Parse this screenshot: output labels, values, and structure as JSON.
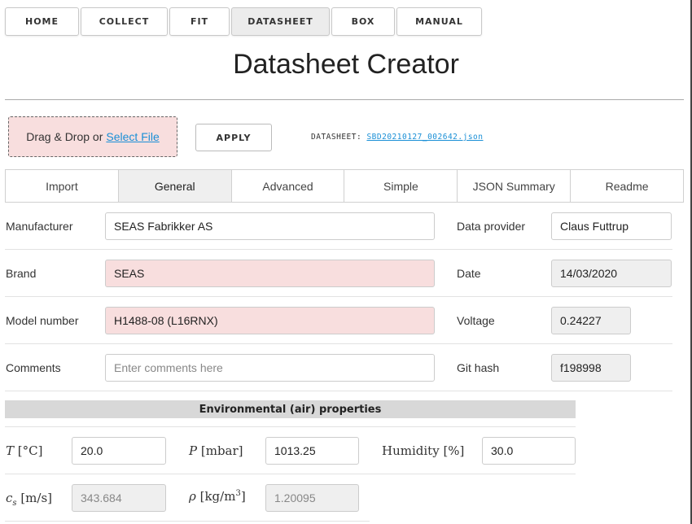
{
  "nav": {
    "items": [
      {
        "label": "HOME"
      },
      {
        "label": "COLLECT"
      },
      {
        "label": "FIT"
      },
      {
        "label": "DATASHEET",
        "active": true
      },
      {
        "label": "BOX"
      },
      {
        "label": "MANUAL"
      }
    ]
  },
  "page": {
    "title": "Datasheet Creator"
  },
  "upload": {
    "drop_text": "Drag & Drop or",
    "select_link": "Select File",
    "apply_label": "APPLY",
    "datasheet_label": "DATASHEET:",
    "datasheet_file": "SBD20210127_002642.json"
  },
  "tabs": [
    {
      "label": "Import"
    },
    {
      "label": "General",
      "active": true
    },
    {
      "label": "Advanced"
    },
    {
      "label": "Simple"
    },
    {
      "label": "JSON Summary"
    },
    {
      "label": "Readme"
    }
  ],
  "general": {
    "manufacturer_label": "Manufacturer",
    "manufacturer_value": "SEAS Fabrikker AS",
    "brand_label": "Brand",
    "brand_value": "SEAS",
    "model_label": "Model number",
    "model_value": "H1488-08 (L16RNX)",
    "comments_label": "Comments",
    "comments_placeholder": "Enter comments here",
    "provider_label": "Data provider",
    "provider_value": "Claus Futtrup",
    "date_label": "Date",
    "date_value": "14/03/2020",
    "voltage_label": "Voltage",
    "voltage_value": "0.24227",
    "git_label": "Git hash",
    "git_value": "f198998"
  },
  "environment": {
    "header": "Environmental (air) properties",
    "temperature_symbol": "T",
    "temperature_unit": "[°C]",
    "temperature_value": "20.0",
    "pressure_symbol": "P",
    "pressure_unit": "[mbar]",
    "pressure_value": "1013.25",
    "humidity_label": "Humidity",
    "humidity_unit": "[%]",
    "humidity_value": "30.0",
    "sound_speed_symbol": "c",
    "sound_speed_subscript": "s",
    "sound_speed_unit": "[m/s]",
    "sound_speed_value": "343.684",
    "density_symbol": "ρ",
    "density_unit": "[kg/m",
    "density_unit_power": "3",
    "density_unit_close": "]",
    "density_value": "1.20095"
  },
  "colors": {
    "required_field": "#f8dede",
    "readonly_field": "#efefef",
    "link": "#1a8fd6",
    "section_header": "#d8d8d8"
  }
}
